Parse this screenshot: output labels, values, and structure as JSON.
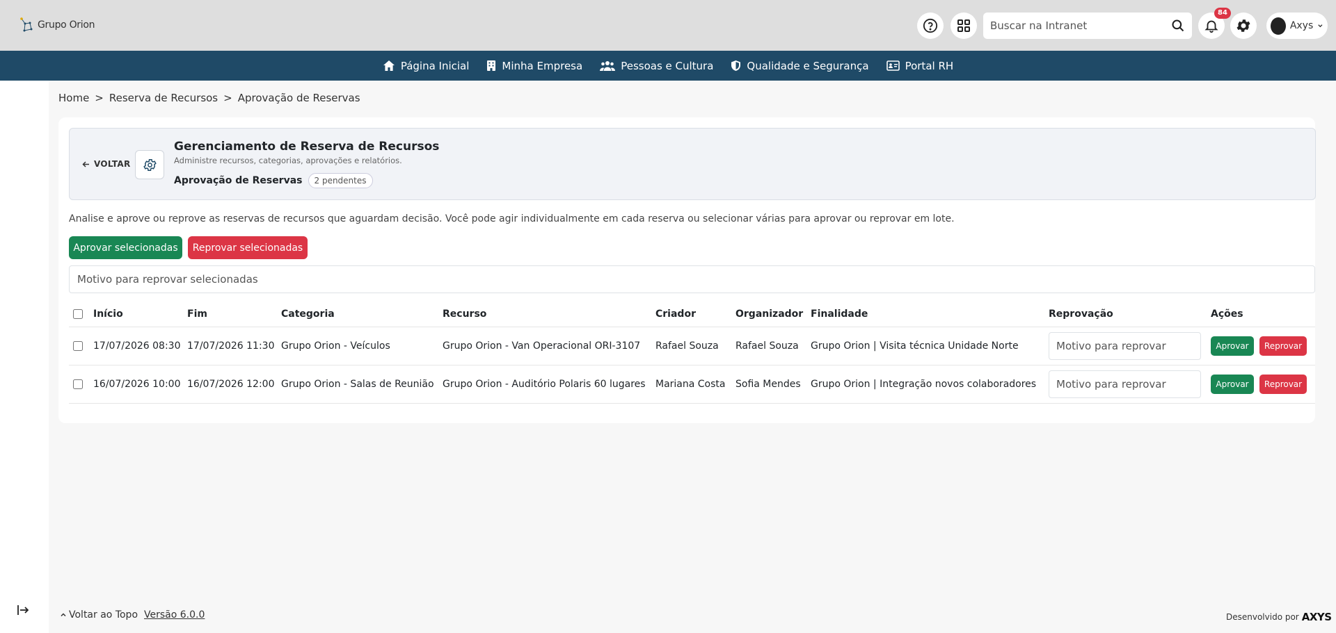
{
  "header": {
    "logo_text": "Grupo Orion",
    "search_placeholder": "Buscar na Intranet",
    "notifications_count": "84",
    "user_name": "Axys"
  },
  "nav": {
    "items": [
      {
        "label": "Página Inicial",
        "icon": "home-icon"
      },
      {
        "label": "Minha Empresa",
        "icon": "building-icon"
      },
      {
        "label": "Pessoas e Cultura",
        "icon": "people-icon"
      },
      {
        "label": "Qualidade e Segurança",
        "icon": "shield-icon"
      },
      {
        "label": "Portal RH",
        "icon": "id-card-icon"
      }
    ]
  },
  "breadcrumb": {
    "items": [
      "Home",
      "Reserva de Recursos",
      "Aprovação de Reservas"
    ],
    "separator": ">"
  },
  "hero": {
    "back_label": "VOLTAR",
    "title": "Gerenciamento de Reserva de Recursos",
    "subtitle": "Administre recursos, categorias, aprovações e relatórios.",
    "section": "Aprovação de Reservas",
    "pending": "2 pendentes"
  },
  "main": {
    "intro": "Analise e aprove ou reprove as reservas de recursos que aguardam decisão. Você pode agir individualmente em cada reserva ou selecionar várias para aprovar ou reprovar em lote.",
    "approve_selected": "Aprovar selecionadas",
    "reject_selected": "Reprovar selecionadas",
    "reject_reason_placeholder": "Motivo para reprovar selecionadas"
  },
  "table": {
    "columns": [
      "Início",
      "Fim",
      "Categoria",
      "Recurso",
      "Criador",
      "Organizador",
      "Finalidade",
      "Reprovação",
      "Ações"
    ],
    "rows": [
      {
        "inicio": "17/07/2026 08:30",
        "fim": "17/07/2026 11:30",
        "categoria": "Grupo Orion - Veículos",
        "recurso": "Grupo Orion - Van Operacional ORI-3107",
        "criador": "Rafael Souza",
        "organizador": "Rafael Souza",
        "finalidade": "Grupo Orion | Visita técnica Unidade Norte",
        "reason_placeholder": "Motivo para reprovar",
        "approve": "Aprovar",
        "reject": "Reprovar"
      },
      {
        "inicio": "16/07/2026 10:00",
        "fim": "16/07/2026 12:00",
        "categoria": "Grupo Orion - Salas de Reunião",
        "recurso": "Grupo Orion - Auditório Polaris 60 lugares",
        "criador": "Mariana Costa",
        "organizador": "Sofia Mendes",
        "finalidade": "Grupo Orion | Integração novos colaboradores",
        "reason_placeholder": "Motivo para reprovar",
        "approve": "Aprovar",
        "reject": "Reprovar"
      }
    ]
  },
  "footer": {
    "back_to_top": "Voltar ao Topo",
    "version": "Versão 6.0.0",
    "developed_by": "Desenvolvido por",
    "brand": "AXYS"
  },
  "colors": {
    "navbar": "#1f4a67",
    "approve": "#198754",
    "reject": "#dc3545",
    "topbar": "#dedede"
  }
}
